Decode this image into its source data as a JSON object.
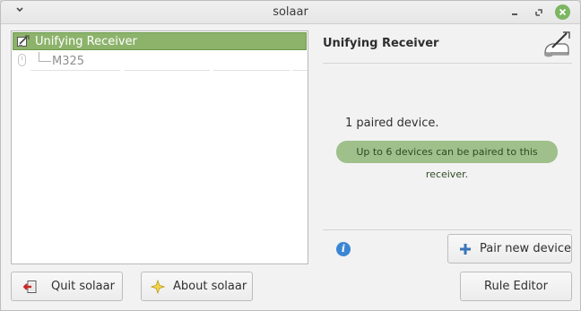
{
  "window": {
    "title": "solaar"
  },
  "tree": {
    "receiver_label": "Unifying Receiver",
    "device_label": "M325"
  },
  "panel": {
    "title": "Unifying Receiver",
    "paired_text": "1 paired device.",
    "notice_text": "Up to 6 devices can be paired to this receiver."
  },
  "buttons": {
    "pair": "Pair new device",
    "quit": "Quit solaar",
    "about": "About solaar",
    "rule_editor": "Rule Editor"
  },
  "colors": {
    "selection": "#8db36b",
    "notice_bg": "#9fc08a",
    "close_button": "#7bb661",
    "info_icon": "#3b86d4"
  },
  "icons": {
    "menu": "chevron-down-icon",
    "minimize": "minimize-icon",
    "maximize": "maximize-icon",
    "close": "close-icon",
    "receiver": "receiver-icon",
    "device": "mouse-icon",
    "panel": "receiver-large-icon",
    "info": "info-icon",
    "pair": "plus-icon",
    "quit": "exit-icon",
    "about": "star-icon"
  }
}
